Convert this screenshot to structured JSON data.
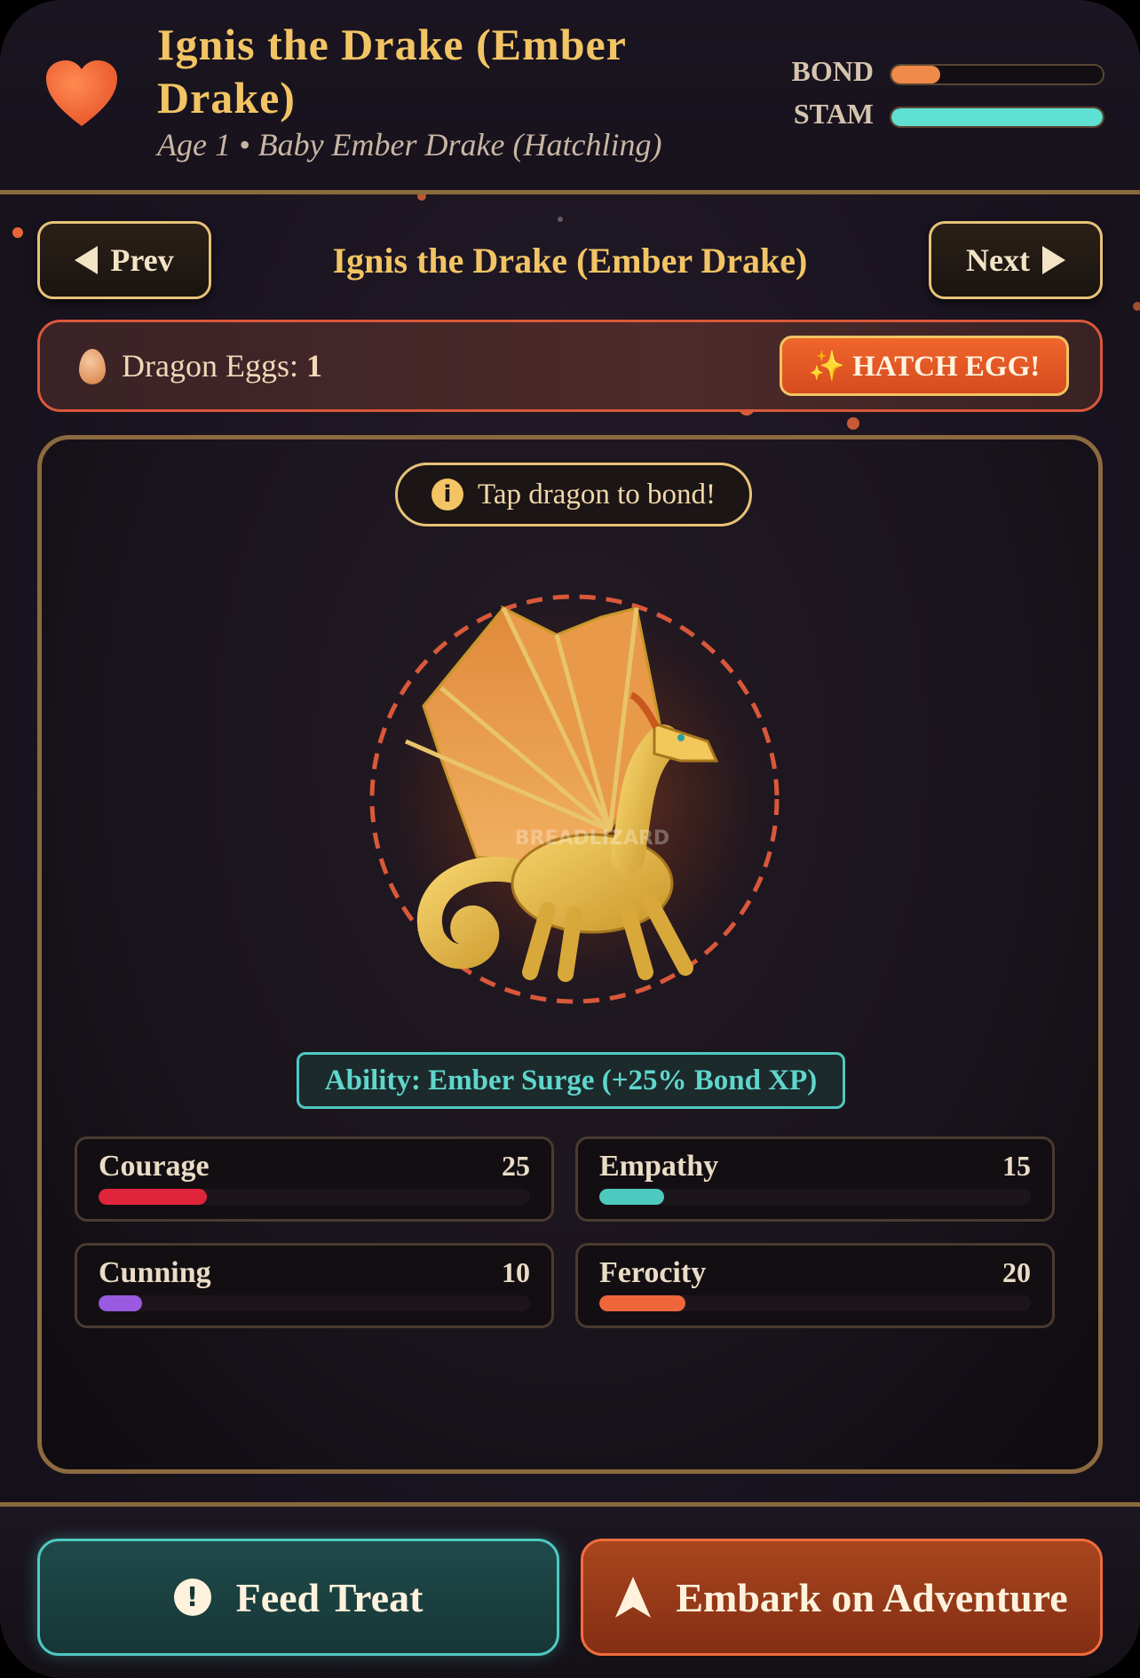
{
  "header": {
    "title": "Ignis the Drake (Ember Drake)",
    "subtitle": "Age 1 • Baby Ember Drake (Hatchling)",
    "meters": [
      {
        "label": "BOND",
        "value": 0.23,
        "color": "#f08a4a"
      },
      {
        "label": "STAM",
        "value": 1.0,
        "color": "#5fe0d2"
      }
    ]
  },
  "nav": {
    "prev_label": "Prev",
    "next_label": "Next",
    "title": "Ignis the Drake (Ember Drake)"
  },
  "eggs": {
    "label": "Dragon Eggs:",
    "count": "1",
    "hatch_label": "✨ HATCH EGG!"
  },
  "dragon": {
    "hint": "Tap dragon to bond!",
    "watermark": "BREADLIZARD",
    "ability": "Ability: Ember Surge (+25% Bond XP)"
  },
  "stats": [
    {
      "name": "Courage",
      "value": "25",
      "fill": 0.25,
      "color": "#e0243c"
    },
    {
      "name": "Empathy",
      "value": "15",
      "fill": 0.15,
      "color": "#4ec9c0"
    },
    {
      "name": "Cunning",
      "value": "10",
      "fill": 0.1,
      "color": "#9a5ae0"
    },
    {
      "name": "Ferocity",
      "value": "20",
      "fill": 0.2,
      "color": "#f0663c"
    }
  ],
  "footer": {
    "feed_label": "Feed Treat",
    "adventure_label": "Embark on Adventure"
  }
}
